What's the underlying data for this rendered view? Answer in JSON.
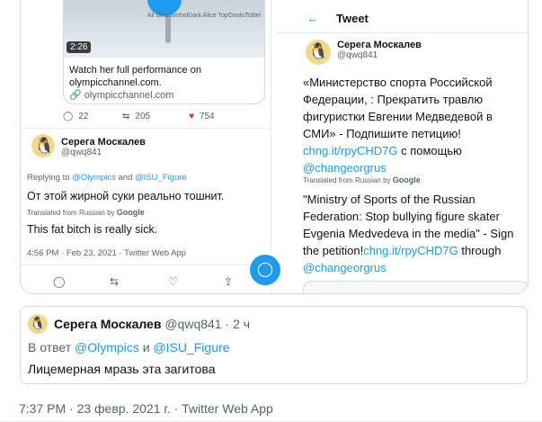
{
  "left_tweet": {
    "video_duration": "2:26",
    "video_watermark": "Ali GeisSimhoiDark\nAlice TopGeoloToBel",
    "card_text": "Watch her full performance on olympicchannel.com.",
    "card_link": "olympicchannel.com",
    "actions": {
      "replies": "22",
      "retweets": "205",
      "likes": "754"
    }
  },
  "left_reply": {
    "name": "Серега Москалев",
    "handle": "@qwq841",
    "replying_prefix": "Replying to",
    "replying_to_1": "@Olympics",
    "replying_and": "and",
    "replying_to_2": "@ISU_Figure",
    "text_ru": "От этой жирной суки реально тошнит.",
    "translated_label": "Translated from Russian by",
    "google": "Google",
    "text_en": "This fat bitch is really sick.",
    "meta": "4:56 PM · Feb 23, 2021 · Twitter Web App"
  },
  "right_tweet": {
    "header_title": "Tweet",
    "more": "···",
    "name": "Серега Москалев",
    "handle": "@qwq841",
    "body_ru_text": "«Министерство спорта Российской Федерации, : Прекратить травлю фигуристки Евгении Медведевой в СМИ» - Подпишите петицию!",
    "body_ru_link": "chng.it/rpyCHD7G",
    "body_ru_mid": "с помощью",
    "body_ru_mention": "@changeorgrus",
    "translated_label": "Translated from Russian by",
    "google": "Google",
    "body_en_text": "\"Ministry of Sports of the Russian Federation: Stop bullying figure skater Evgenia Medvedeva in the media\" - Sign the petition!",
    "body_en_link": "chng.it/rpyCHD7G",
    "body_en_mid": "through",
    "body_en_mention": "@changeorgrus"
  },
  "reply_box": {
    "name": "Серега Москалев",
    "handle": "@qwq841",
    "time": "2 ч",
    "reply_prefix": "В ответ",
    "reply_to_1": "@Olympics",
    "reply_and": "и",
    "reply_to_2": "@ISU_Figure",
    "text": "Лицемерная мразь эта загитова"
  },
  "footer": "7:37 PM · 23 февр. 2021 г. · Twitter Web App",
  "colors": {
    "accent": "#1d9bf0",
    "like": "#e0245e",
    "muted": "#536471",
    "border": "#cfd9de"
  }
}
